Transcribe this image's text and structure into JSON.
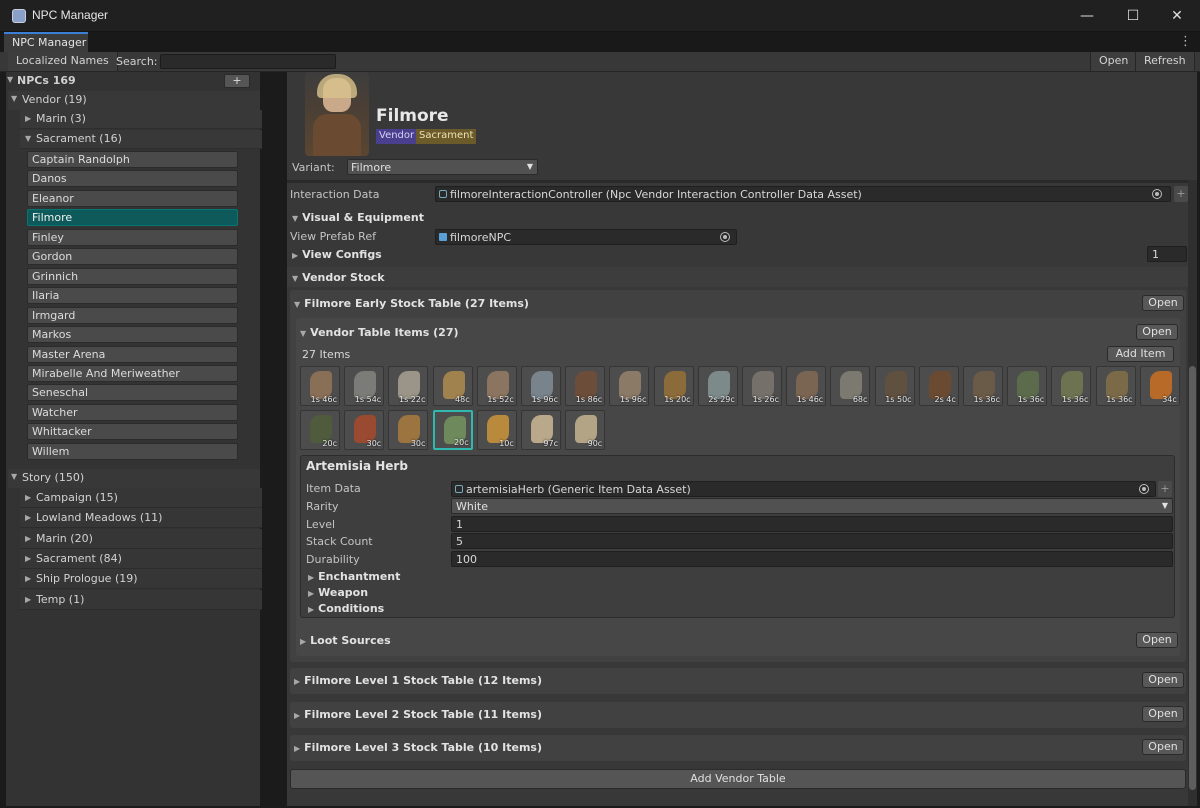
{
  "window": {
    "title": "NPC Manager",
    "minimize": "—",
    "maximize": "☐",
    "close": "✕"
  },
  "tab": {
    "label": "NPC Manager",
    "menu": "⋮"
  },
  "toolbar": {
    "localized_names": "Localized Names",
    "search_label": "Search:",
    "search_value": "",
    "open": "Open",
    "refresh": "Refresh"
  },
  "sidebar": {
    "npcs_header": "NPCs 169",
    "add": "+",
    "vendor": {
      "label": "Vendor (19)",
      "marin": "Marin (3)",
      "sacrament": "Sacrament (16)",
      "items": [
        "Captain Randolph",
        "Danos",
        "Eleanor",
        "Filmore",
        "Finley",
        "Gordon",
        "Grinnich",
        "Ilaria",
        "Irmgard",
        "Markos",
        "Master Arena",
        "Mirabelle And Meriweather",
        "Seneschal",
        "Watcher",
        "Whittacker",
        "Willem"
      ],
      "selected": "Filmore"
    },
    "story": {
      "label": "Story (150)",
      "groups": [
        "Campaign (15)",
        "Lowland Meadows (11)",
        "Marin (20)",
        "Sacrament (84)",
        "Ship Prologue (19)",
        "Temp (1)"
      ]
    }
  },
  "npc": {
    "name": "Filmore",
    "tags": [
      "Vendor",
      "Sacrament"
    ],
    "variant_label": "Variant:",
    "variant_value": "Filmore"
  },
  "inspector": {
    "interaction_label": "Interaction Data",
    "interaction_value": "filmoreInteractionController (Npc Vendor Interaction Controller Data Asset)",
    "visual_header": "Visual & Equipment",
    "view_prefab_label": "View Prefab Ref",
    "view_prefab_value": "filmoreNPC",
    "view_configs_label": "View Configs",
    "view_configs_value": "1",
    "vendor_stock_header": "Vendor Stock",
    "early_table": "Filmore Early Stock Table (27 Items)",
    "open": "Open",
    "vendor_table_items": "Vendor Table Items (27)",
    "items_count": "27 Items",
    "add_item": "Add Item",
    "items": [
      {
        "price": "1s 46c",
        "color": "#8a6f57"
      },
      {
        "price": "1s 54c",
        "color": "#7b7b78"
      },
      {
        "price": "1s 22c",
        "color": "#9a9588"
      },
      {
        "price": "48c",
        "color": "#a0824e"
      },
      {
        "price": "1s 52c",
        "color": "#8b7560"
      },
      {
        "price": "1s 96c",
        "color": "#78838c"
      },
      {
        "price": "1s 86c",
        "color": "#6b4d3a"
      },
      {
        "price": "1s 96c",
        "color": "#8a7a66"
      },
      {
        "price": "1s 20c",
        "color": "#8c6b3a"
      },
      {
        "price": "2s 29c",
        "color": "#7d8a8a"
      },
      {
        "price": "1s 26c",
        "color": "#76706a"
      },
      {
        "price": "1s 46c",
        "color": "#7a6452"
      },
      {
        "price": "68c",
        "color": "#7c7a70"
      },
      {
        "price": "1s 50c",
        "color": "#5f5040"
      },
      {
        "price": "2s 4c",
        "color": "#6b4a32"
      },
      {
        "price": "1s 36c",
        "color": "#6a5a48"
      },
      {
        "price": "1s 36c",
        "color": "#5d6b4d"
      },
      {
        "price": "1s 36c",
        "color": "#6d7250"
      },
      {
        "price": "1s 36c",
        "color": "#7a6a48"
      },
      {
        "price": "34c",
        "color": "#b86a28"
      },
      {
        "price": "20c",
        "color": "#4f5b3c"
      },
      {
        "price": "30c",
        "color": "#9a4a30"
      },
      {
        "price": "30c",
        "color": "#9b7440"
      },
      {
        "price": "20c",
        "color": "#6e8a5c"
      },
      {
        "price": "10c",
        "color": "#b98a3c"
      },
      {
        "price": "97c",
        "color": "#b9a88a"
      },
      {
        "price": "90c",
        "color": "#b4a486"
      }
    ],
    "selected_item": "Artemisia Herb",
    "item_data_label": "Item Data",
    "item_data_value": "artemisiaHerb (Generic Item Data Asset)",
    "rarity_label": "Rarity",
    "rarity_value": "White",
    "level_label": "Level",
    "level_value": "1",
    "stack_label": "Stack Count",
    "stack_value": "5",
    "durability_label": "Durability",
    "durability_value": "100",
    "enchantment": "Enchantment",
    "weapon": "Weapon",
    "conditions": "Conditions",
    "loot_sources": "Loot Sources",
    "level1": "Filmore Level 1 Stock Table (12 Items)",
    "level2": "Filmore Level 2 Stock Table (11 Items)",
    "level3": "Filmore Level 3 Stock Table (10 Items)",
    "add_vendor_table": "Add Vendor Table"
  },
  "colors": {
    "accent": "#3b7fd6",
    "selected_teal": "#0e5a5a",
    "vendor_tag": "#4a3f8f",
    "sacrament_tag": "#6b5a2a"
  }
}
